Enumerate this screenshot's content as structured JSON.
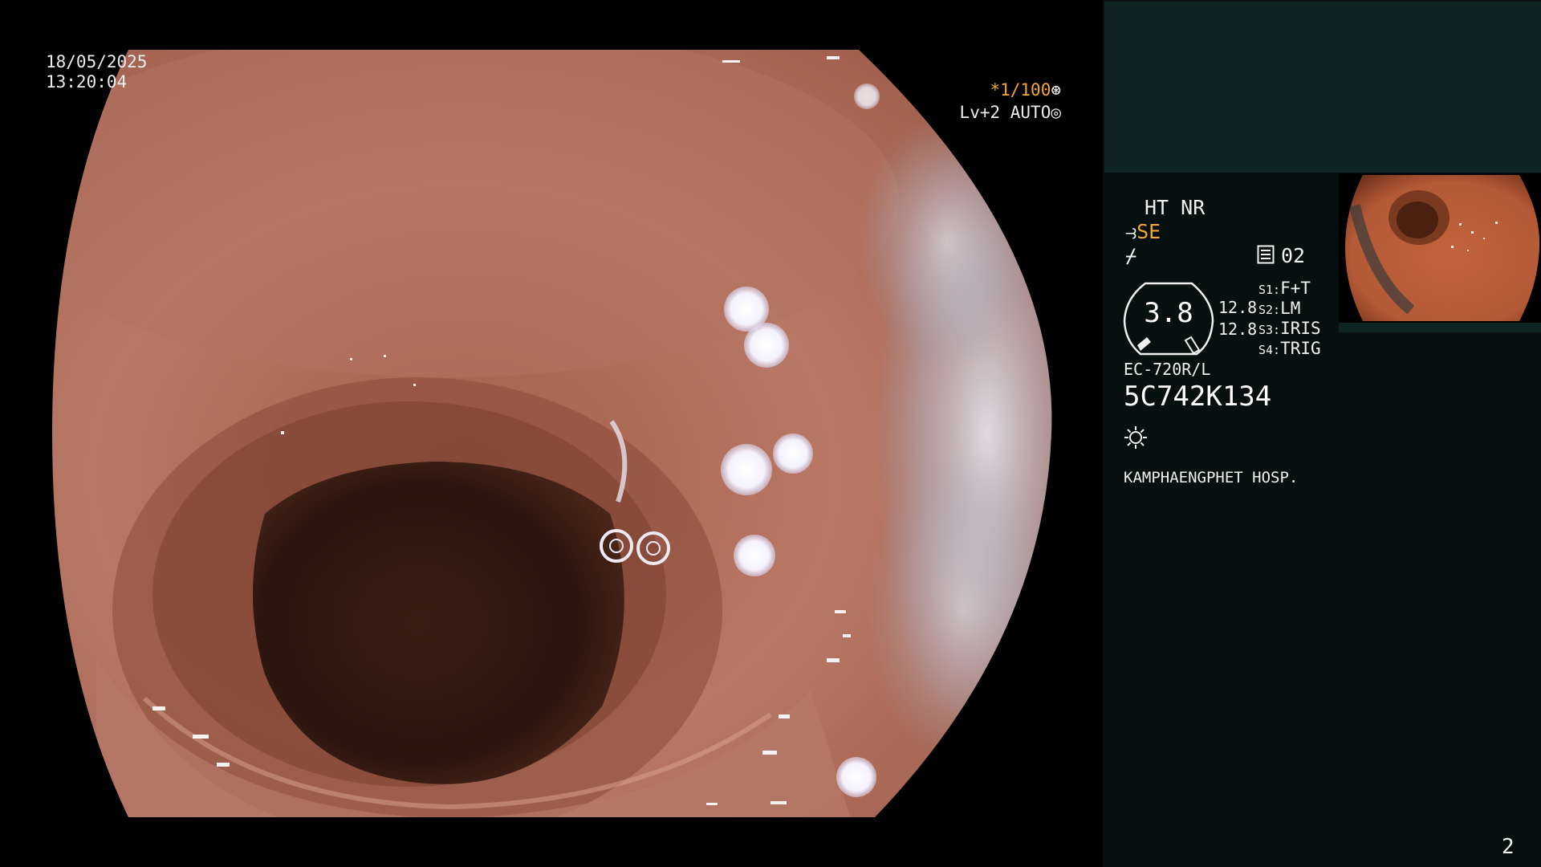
{
  "overlay": {
    "date": "18/05/2025",
    "time": "13:20:04",
    "shutter": "*1/100",
    "level": "Lv+2 AUTO"
  },
  "panel": {
    "enhancement": "HT NR",
    "mode": "SE",
    "memo_number": "02",
    "gauge_value": "3.8",
    "value_1": "12.8",
    "value_2": "12.8",
    "switches": [
      {
        "key": "S1:",
        "value": "F+T"
      },
      {
        "key": "S2:",
        "value": "LM"
      },
      {
        "key": "S3:",
        "value": "IRIS"
      },
      {
        "key": "S4:",
        "value": "TRIG"
      }
    ],
    "scope_model": "EC-720R/L",
    "scope_serial": "5C742K134",
    "hospital": "KAMPHAENGPHET HOSP.",
    "page_number": "2"
  },
  "colors": {
    "highlight": "#f2a531",
    "panel_bg": "#06110f",
    "panel_top_bg": "#0e2423",
    "tissue": "#b57563",
    "lumen": "#2a140d"
  }
}
